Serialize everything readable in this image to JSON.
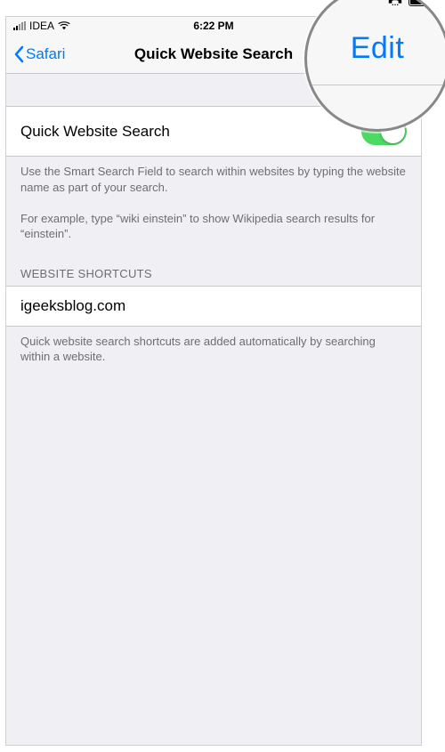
{
  "statusBar": {
    "carrier": "IDEA",
    "time": "6:22 PM"
  },
  "nav": {
    "backLabel": "Safari",
    "title": "Quick Website Search",
    "editLabel": "Edit"
  },
  "toggleRow": {
    "label": "Quick Website Search",
    "on": true
  },
  "description": {
    "para1": "Use the Smart Search Field to search within websites by typing the website name as part of your search.",
    "para2": "For example, type “wiki einstein” to show Wikipedia search results for “einstein”."
  },
  "shortcuts": {
    "header": "WEBSITE SHORTCUTS",
    "items": [
      {
        "domain": "igeeksblog.com"
      }
    ],
    "footer": "Quick website search shortcuts are added automatically by searching within a website."
  },
  "magnifier": {
    "editLabel": "Edit"
  }
}
